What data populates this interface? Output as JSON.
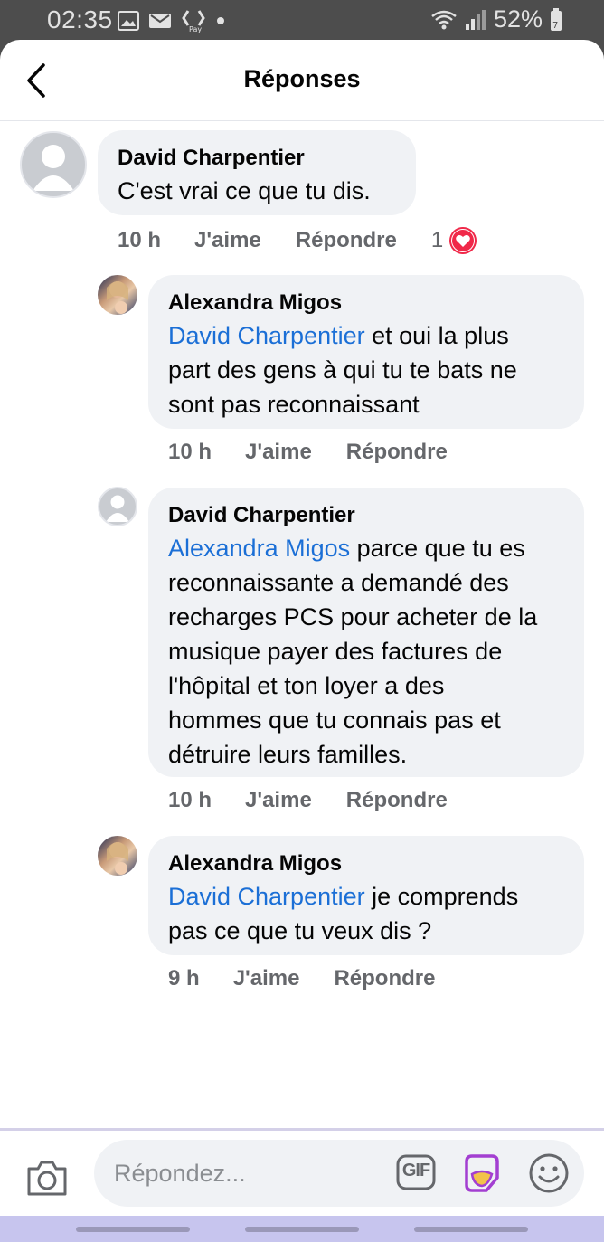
{
  "status_bar": {
    "time": "02:35",
    "battery": "52%",
    "icons": [
      "image-icon",
      "mail-icon",
      "pay-icon",
      "dot-icon",
      "wifi-icon",
      "signal-icon",
      "battery-icon"
    ]
  },
  "header": {
    "title": "Réponses",
    "back_icon": "chevron-left-icon"
  },
  "comments": [
    {
      "author": "David Charpentier",
      "mention": "",
      "text": "C'est vrai ce que tu dis.",
      "time": "10 h",
      "like": "J'aime",
      "reply": "Répondre",
      "reaction_count": "1",
      "reaction_icon": "heart-icon"
    },
    {
      "author": "Alexandra Migos",
      "mention": "David Charpentier",
      "text_line1": " et oui la plus",
      "text_line2": "part des gens à qui tu te bats ne",
      "text_line3": "sont pas reconnaissant",
      "time": "10 h",
      "like": "J'aime",
      "reply": "Répondre"
    },
    {
      "author": "David Charpentier",
      "mention": "Alexandra Migos",
      "text_line1": " parce que tu es",
      "text_line2": "reconnaissante a demandé des",
      "text_line3": "recharges PCS pour acheter de la",
      "text_line4": "musique payer des factures de",
      "text_line5": "l'hôpital et ton loyer a des",
      "text_line6": "hommes que tu connais pas et",
      "text_line7": "détruire leurs familles.",
      "time": "10 h",
      "like": "J'aime",
      "reply": "Répondre"
    },
    {
      "author": "Alexandra Migos",
      "mention": "David Charpentier",
      "text_line1": " je comprends",
      "text_line2": "pas ce que tu veux dis ?",
      "time": "9 h",
      "like": "J'aime",
      "reply": "Répondre"
    }
  ],
  "composer": {
    "placeholder": "Répondez...",
    "gif_label": "GIF",
    "icons": [
      "camera-icon",
      "gif-icon",
      "sticker-icon",
      "emoji-icon"
    ]
  },
  "colors": {
    "mention": "#1b6fd6",
    "bubble": "#f0f2f5",
    "meta_text": "#65676b",
    "heart": "#f02849",
    "sticker": "#a33fd1"
  }
}
